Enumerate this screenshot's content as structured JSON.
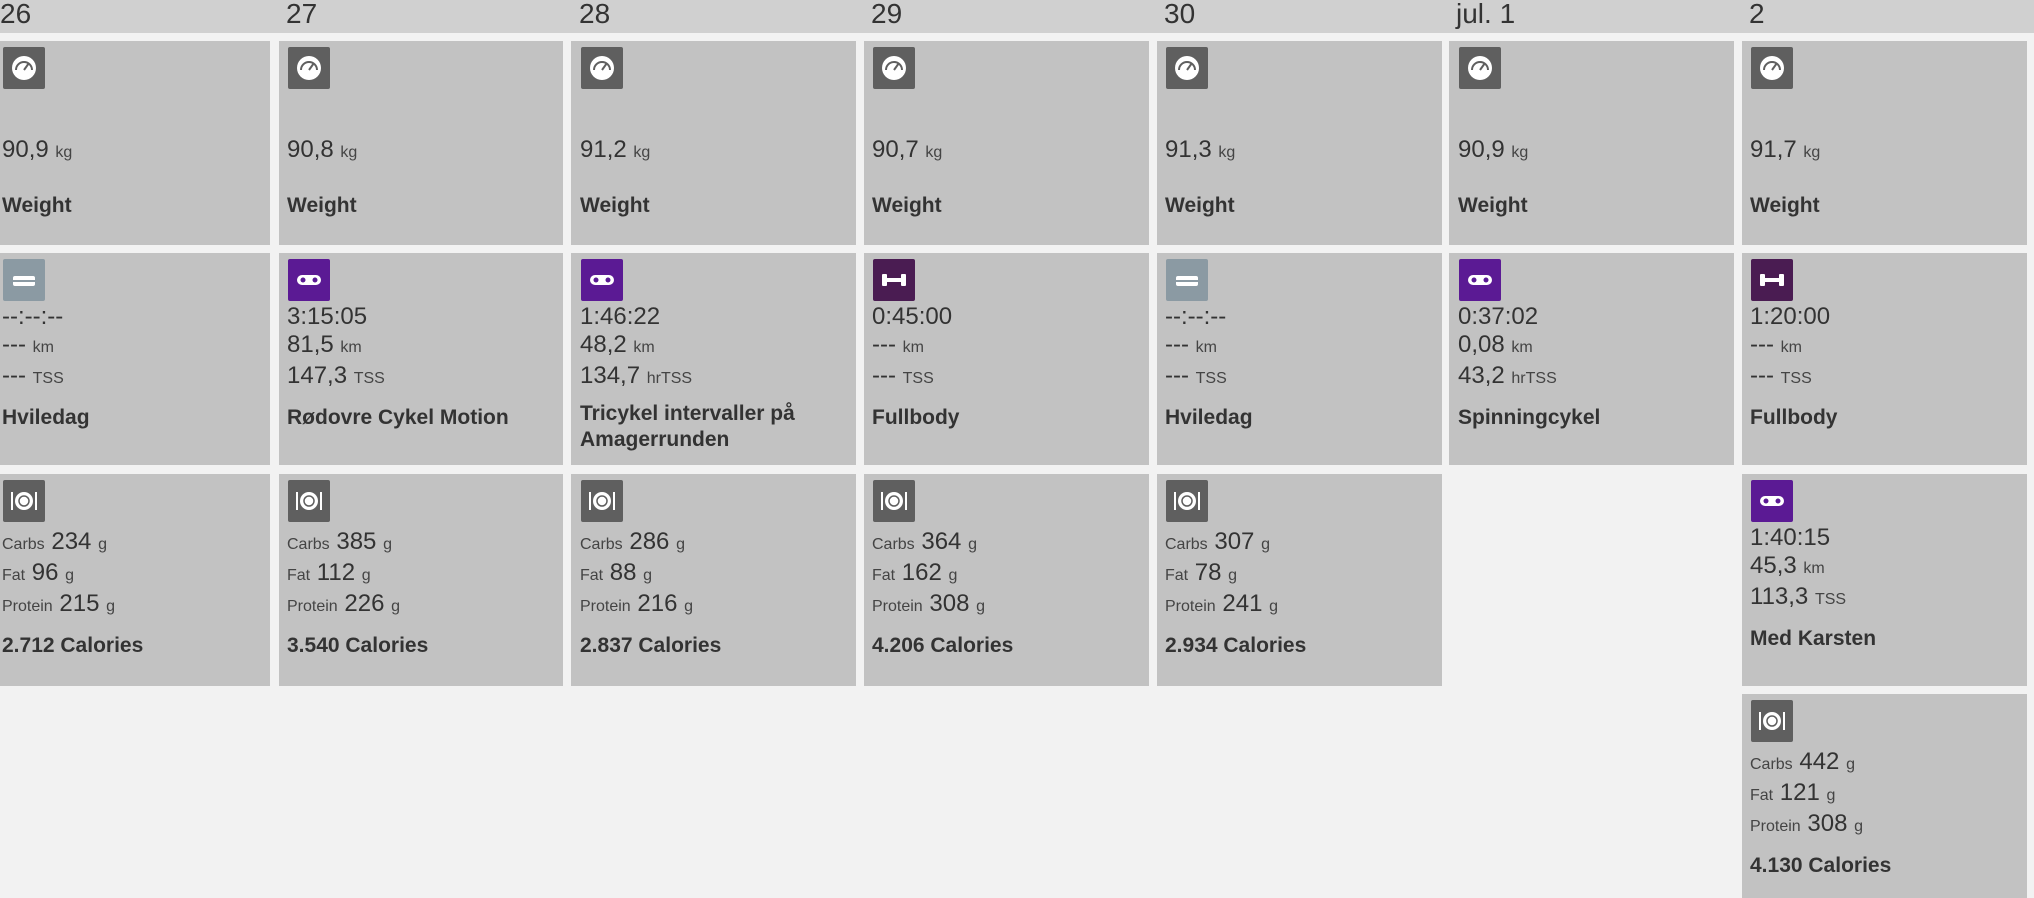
{
  "days": [
    {
      "label": "26",
      "weight": {
        "value": "90,9",
        "unit": "kg",
        "title": "Weight"
      },
      "workout": {
        "kind": "rest",
        "icon": "sofa-icon",
        "duration": "--:--:--",
        "distance": "---",
        "distance_unit": "km",
        "load": "---",
        "load_unit": "TSS",
        "title": "Hviledag"
      },
      "nutrition": {
        "carbs_label": "Carbs",
        "carbs": "234",
        "fat_label": "Fat",
        "fat": "96",
        "protein_label": "Protein",
        "protein": "215",
        "unit": "g",
        "title": "2.712 Calories"
      }
    },
    {
      "label": "27",
      "weight": {
        "value": "90,8",
        "unit": "kg",
        "title": "Weight"
      },
      "workout": {
        "kind": "bike",
        "icon": "bike-icon",
        "duration": "3:15:05",
        "distance": "81,5",
        "distance_unit": "km",
        "load": "147,3",
        "load_unit": "TSS",
        "title": "Rødovre Cykel Motion"
      },
      "nutrition": {
        "carbs_label": "Carbs",
        "carbs": "385",
        "fat_label": "Fat",
        "fat": "112",
        "protein_label": "Protein",
        "protein": "226",
        "unit": "g",
        "title": "3.540 Calories"
      }
    },
    {
      "label": "28",
      "weight": {
        "value": "91,2",
        "unit": "kg",
        "title": "Weight"
      },
      "workout": {
        "kind": "bike",
        "icon": "bike-icon",
        "duration": "1:46:22",
        "distance": "48,2",
        "distance_unit": "km",
        "load": "134,7",
        "load_unit": "hrTSS",
        "title": "Tricykel intervaller på Amagerrunden"
      },
      "nutrition": {
        "carbs_label": "Carbs",
        "carbs": "286",
        "fat_label": "Fat",
        "fat": "88",
        "protein_label": "Protein",
        "protein": "216",
        "unit": "g",
        "title": "2.837 Calories"
      }
    },
    {
      "label": "29",
      "weight": {
        "value": "90,7",
        "unit": "kg",
        "title": "Weight"
      },
      "workout": {
        "kind": "strength",
        "icon": "dumbbell-icon",
        "duration": "0:45:00",
        "distance": "---",
        "distance_unit": "km",
        "load": "---",
        "load_unit": "TSS",
        "title": "Fullbody"
      },
      "nutrition": {
        "carbs_label": "Carbs",
        "carbs": "364",
        "fat_label": "Fat",
        "fat": "162",
        "protein_label": "Protein",
        "protein": "308",
        "unit": "g",
        "title": "4.206 Calories"
      }
    },
    {
      "label": "30",
      "weight": {
        "value": "91,3",
        "unit": "kg",
        "title": "Weight"
      },
      "workout": {
        "kind": "rest",
        "icon": "sofa-icon",
        "duration": "--:--:--",
        "distance": "---",
        "distance_unit": "km",
        "load": "---",
        "load_unit": "TSS",
        "title": "Hviledag"
      },
      "nutrition": {
        "carbs_label": "Carbs",
        "carbs": "307",
        "fat_label": "Fat",
        "fat": "78",
        "protein_label": "Protein",
        "protein": "241",
        "unit": "g",
        "title": "2.934 Calories"
      }
    },
    {
      "label": "jul. 1",
      "weight": {
        "value": "90,9",
        "unit": "kg",
        "title": "Weight"
      },
      "workout": {
        "kind": "bike",
        "icon": "bike-icon",
        "duration": "0:37:02",
        "distance": "0,08",
        "distance_unit": "km",
        "load": "43,2",
        "load_unit": "hrTSS",
        "title": "Spinningcykel"
      }
    },
    {
      "label": "2",
      "weight": {
        "value": "91,7",
        "unit": "kg",
        "title": "Weight"
      },
      "workout": {
        "kind": "strength",
        "icon": "dumbbell-icon",
        "duration": "1:20:00",
        "distance": "---",
        "distance_unit": "km",
        "load": "---",
        "load_unit": "TSS",
        "title": "Fullbody"
      },
      "workout2": {
        "kind": "bike",
        "icon": "bike-icon",
        "duration": "1:40:15",
        "distance": "45,3",
        "distance_unit": "km",
        "load": "113,3",
        "load_unit": "TSS",
        "title": "Med Karsten"
      },
      "nutrition": {
        "carbs_label": "Carbs",
        "carbs": "442",
        "fat_label": "Fat",
        "fat": "121",
        "protein_label": "Protein",
        "protein": "308",
        "unit": "g",
        "title": "4.130 Calories"
      }
    }
  ],
  "colors": {
    "header": "#d0d0d0",
    "card": "#c2c2c2",
    "background": "#f2f2f2",
    "bike_icon": "#5b1a94",
    "strength_icon": "#4a1c52",
    "rest_icon": "#8b9aa3",
    "metric_icon": "#5f5f5f"
  }
}
